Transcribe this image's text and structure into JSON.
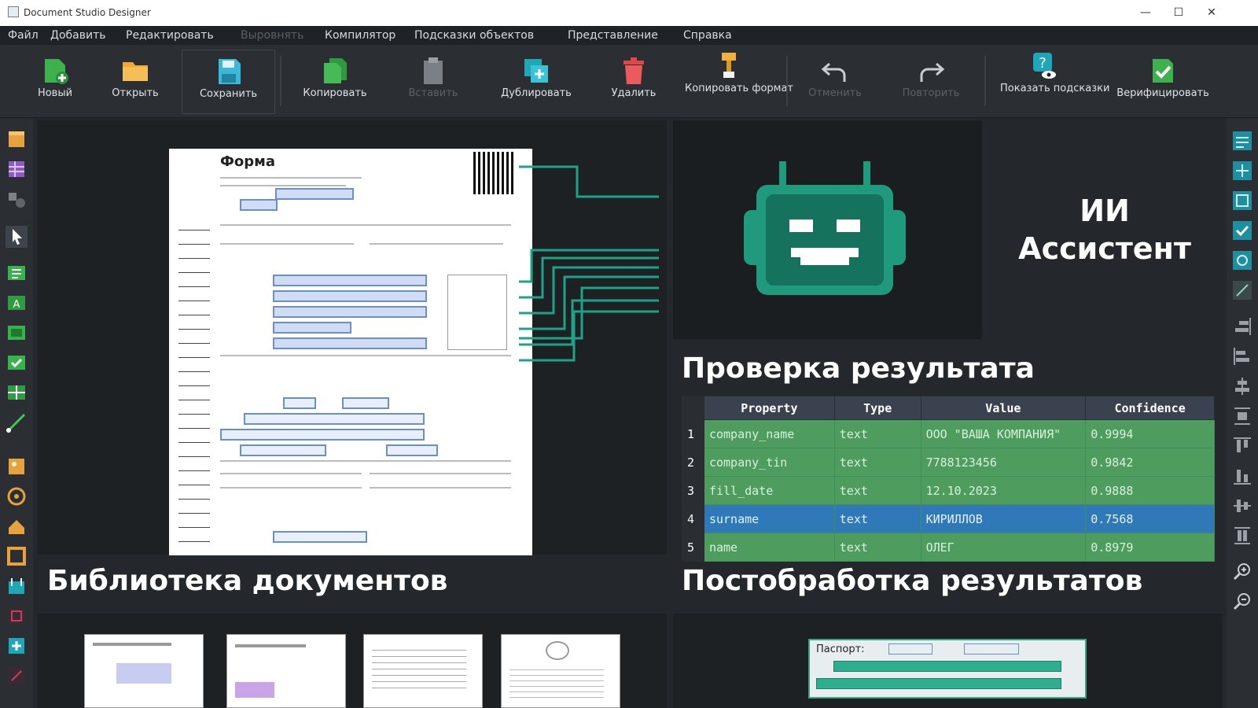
{
  "window": {
    "title": "Document Studio Designer",
    "controls": [
      "—",
      "☐",
      "✕"
    ]
  },
  "menu": [
    {
      "label": "Файл",
      "enabled": true
    },
    {
      "label": "Добавить",
      "enabled": true
    },
    {
      "label": "Редактировать",
      "enabled": true
    },
    {
      "label": "Выровнять",
      "enabled": false
    },
    {
      "label": "Компилятор",
      "enabled": true
    },
    {
      "label": "Подсказки объектов",
      "enabled": true
    },
    {
      "label": "Представление",
      "enabled": true
    },
    {
      "label": "Справка",
      "enabled": true
    }
  ],
  "toolbar": {
    "new": "Новый",
    "open": "Открыть",
    "save": "Сохранить",
    "copy": "Копировать",
    "paste": "Вставить",
    "duplicate": "Дублировать",
    "delete": "Удалить",
    "copy_format": "Копировать формат",
    "undo": "Отменить",
    "redo": "Повторить",
    "show_hints": "Показать подсказки",
    "verify": "Верифицировать"
  },
  "form": {
    "title": "Форма"
  },
  "ai": {
    "label": "ИИ Ассистент",
    "robot_icon": "robot-icon",
    "accent": "#1f9a7c"
  },
  "sections": {
    "result_check": "Проверка результата",
    "library": "Библиотека документов",
    "postprocessing": "Постобработка результатов"
  },
  "result_table": {
    "headers": [
      "Property",
      "Type",
      "Value",
      "Confidence"
    ],
    "rows": [
      {
        "n": "1",
        "property": "company_name",
        "type": "text",
        "value": "ООО \"ВАША КОМПАНИЯ\"",
        "confidence": "0.9994",
        "selected": false
      },
      {
        "n": "2",
        "property": "company_tin",
        "type": "text",
        "value": "7788123456",
        "confidence": "0.9842",
        "selected": false
      },
      {
        "n": "3",
        "property": "fill_date",
        "type": "text",
        "value": "12.10.2023",
        "confidence": "0.9888",
        "selected": false
      },
      {
        "n": "4",
        "property": "surname",
        "type": "text",
        "value": "КИРИЛЛОВ",
        "confidence": "0.7568",
        "selected": true
      },
      {
        "n": "5",
        "property": "name",
        "type": "text",
        "value": "ОЛЕГ",
        "confidence": "0.8979",
        "selected": false
      }
    ],
    "colors": {
      "ok": "#4e9c5e",
      "selected": "#2f79b8"
    }
  },
  "postprocessing": {
    "preview_label": "Паспорт:"
  }
}
